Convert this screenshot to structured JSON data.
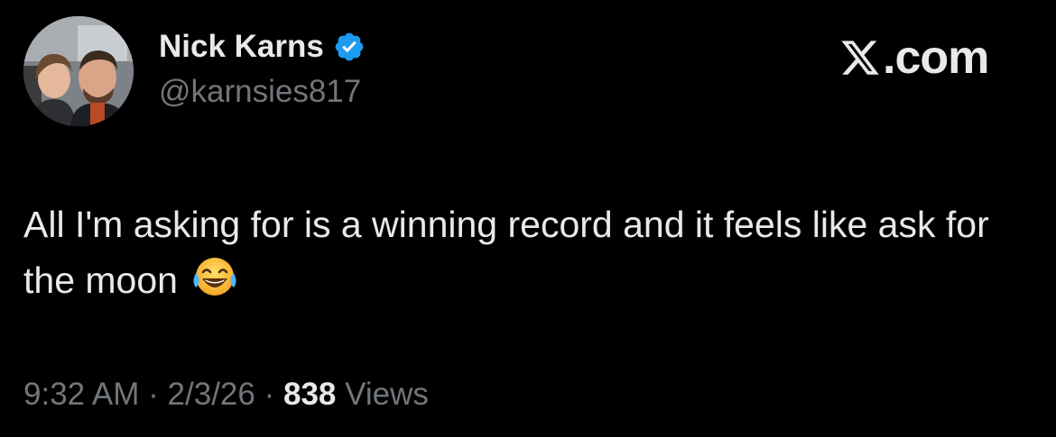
{
  "author": {
    "display_name": "Nick Karns",
    "handle": "@karnsies817",
    "verified": true,
    "verified_color": "#1d9bf0",
    "avatar_icon": "profile-photo"
  },
  "brand": {
    "text": ".com",
    "icon": "x-logo-icon"
  },
  "tweet": {
    "text": "All I'm asking for is a winning record and it feels like ask for the moon",
    "emoji": "face-with-tears-of-joy"
  },
  "meta": {
    "time": "9:32 AM",
    "date": "2/3/26",
    "separator": "·",
    "views_count": "838",
    "views_label": "Views"
  },
  "colors": {
    "background": "#000000",
    "text_primary": "#e7e9ea",
    "text_secondary": "#71767b"
  }
}
